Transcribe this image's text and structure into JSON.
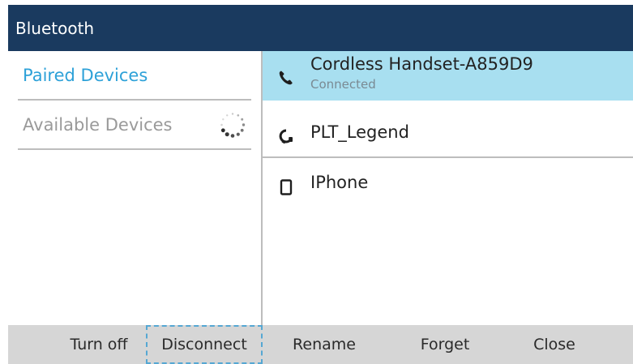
{
  "header": {
    "title": "Bluetooth"
  },
  "sidebar": {
    "items": [
      {
        "label": "Paired Devices"
      },
      {
        "label": "Available Devices"
      }
    ]
  },
  "devices": [
    {
      "name": "Cordless Handset-A859D9",
      "status": "Connected",
      "icon": "phone-handset-icon"
    },
    {
      "name": "PLT_Legend",
      "icon": "headset-icon"
    },
    {
      "name": "IPhone",
      "icon": "mobile-phone-icon"
    }
  ],
  "softkeys": {
    "turn_off": "Turn off",
    "disconnect": "Disconnect",
    "rename": "Rename",
    "forget": "Forget",
    "close": "Close"
  },
  "colors": {
    "titlebar": "#1a3a5f",
    "accent": "#2da1d8",
    "selection": "#a8dff0",
    "softkey_bar": "#d6d6d6"
  }
}
